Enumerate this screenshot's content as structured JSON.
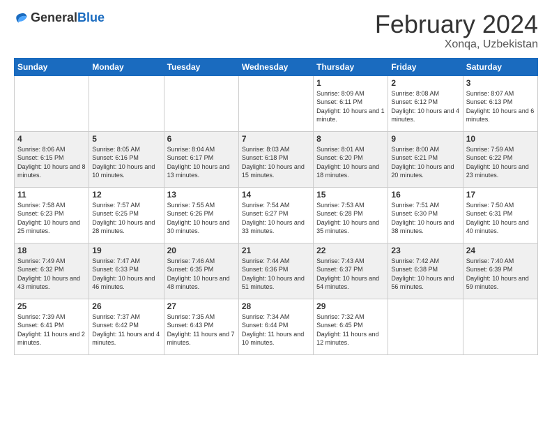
{
  "header": {
    "logo": {
      "text_general": "General",
      "text_blue": "Blue"
    },
    "title": "February 2024",
    "location": "Xonqa, Uzbekistan"
  },
  "calendar": {
    "days_of_week": [
      "Sunday",
      "Monday",
      "Tuesday",
      "Wednesday",
      "Thursday",
      "Friday",
      "Saturday"
    ],
    "weeks": [
      [
        {
          "day": "",
          "info": ""
        },
        {
          "day": "",
          "info": ""
        },
        {
          "day": "",
          "info": ""
        },
        {
          "day": "",
          "info": ""
        },
        {
          "day": "1",
          "info": "Sunrise: 8:09 AM\nSunset: 6:11 PM\nDaylight: 10 hours and 1 minute."
        },
        {
          "day": "2",
          "info": "Sunrise: 8:08 AM\nSunset: 6:12 PM\nDaylight: 10 hours and 4 minutes."
        },
        {
          "day": "3",
          "info": "Sunrise: 8:07 AM\nSunset: 6:13 PM\nDaylight: 10 hours and 6 minutes."
        }
      ],
      [
        {
          "day": "4",
          "info": "Sunrise: 8:06 AM\nSunset: 6:15 PM\nDaylight: 10 hours and 8 minutes."
        },
        {
          "day": "5",
          "info": "Sunrise: 8:05 AM\nSunset: 6:16 PM\nDaylight: 10 hours and 10 minutes."
        },
        {
          "day": "6",
          "info": "Sunrise: 8:04 AM\nSunset: 6:17 PM\nDaylight: 10 hours and 13 minutes."
        },
        {
          "day": "7",
          "info": "Sunrise: 8:03 AM\nSunset: 6:18 PM\nDaylight: 10 hours and 15 minutes."
        },
        {
          "day": "8",
          "info": "Sunrise: 8:01 AM\nSunset: 6:20 PM\nDaylight: 10 hours and 18 minutes."
        },
        {
          "day": "9",
          "info": "Sunrise: 8:00 AM\nSunset: 6:21 PM\nDaylight: 10 hours and 20 minutes."
        },
        {
          "day": "10",
          "info": "Sunrise: 7:59 AM\nSunset: 6:22 PM\nDaylight: 10 hours and 23 minutes."
        }
      ],
      [
        {
          "day": "11",
          "info": "Sunrise: 7:58 AM\nSunset: 6:23 PM\nDaylight: 10 hours and 25 minutes."
        },
        {
          "day": "12",
          "info": "Sunrise: 7:57 AM\nSunset: 6:25 PM\nDaylight: 10 hours and 28 minutes."
        },
        {
          "day": "13",
          "info": "Sunrise: 7:55 AM\nSunset: 6:26 PM\nDaylight: 10 hours and 30 minutes."
        },
        {
          "day": "14",
          "info": "Sunrise: 7:54 AM\nSunset: 6:27 PM\nDaylight: 10 hours and 33 minutes."
        },
        {
          "day": "15",
          "info": "Sunrise: 7:53 AM\nSunset: 6:28 PM\nDaylight: 10 hours and 35 minutes."
        },
        {
          "day": "16",
          "info": "Sunrise: 7:51 AM\nSunset: 6:30 PM\nDaylight: 10 hours and 38 minutes."
        },
        {
          "day": "17",
          "info": "Sunrise: 7:50 AM\nSunset: 6:31 PM\nDaylight: 10 hours and 40 minutes."
        }
      ],
      [
        {
          "day": "18",
          "info": "Sunrise: 7:49 AM\nSunset: 6:32 PM\nDaylight: 10 hours and 43 minutes."
        },
        {
          "day": "19",
          "info": "Sunrise: 7:47 AM\nSunset: 6:33 PM\nDaylight: 10 hours and 46 minutes."
        },
        {
          "day": "20",
          "info": "Sunrise: 7:46 AM\nSunset: 6:35 PM\nDaylight: 10 hours and 48 minutes."
        },
        {
          "day": "21",
          "info": "Sunrise: 7:44 AM\nSunset: 6:36 PM\nDaylight: 10 hours and 51 minutes."
        },
        {
          "day": "22",
          "info": "Sunrise: 7:43 AM\nSunset: 6:37 PM\nDaylight: 10 hours and 54 minutes."
        },
        {
          "day": "23",
          "info": "Sunrise: 7:42 AM\nSunset: 6:38 PM\nDaylight: 10 hours and 56 minutes."
        },
        {
          "day": "24",
          "info": "Sunrise: 7:40 AM\nSunset: 6:39 PM\nDaylight: 10 hours and 59 minutes."
        }
      ],
      [
        {
          "day": "25",
          "info": "Sunrise: 7:39 AM\nSunset: 6:41 PM\nDaylight: 11 hours and 2 minutes."
        },
        {
          "day": "26",
          "info": "Sunrise: 7:37 AM\nSunset: 6:42 PM\nDaylight: 11 hours and 4 minutes."
        },
        {
          "day": "27",
          "info": "Sunrise: 7:35 AM\nSunset: 6:43 PM\nDaylight: 11 hours and 7 minutes."
        },
        {
          "day": "28",
          "info": "Sunrise: 7:34 AM\nSunset: 6:44 PM\nDaylight: 11 hours and 10 minutes."
        },
        {
          "day": "29",
          "info": "Sunrise: 7:32 AM\nSunset: 6:45 PM\nDaylight: 11 hours and 12 minutes."
        },
        {
          "day": "",
          "info": ""
        },
        {
          "day": "",
          "info": ""
        }
      ]
    ]
  }
}
